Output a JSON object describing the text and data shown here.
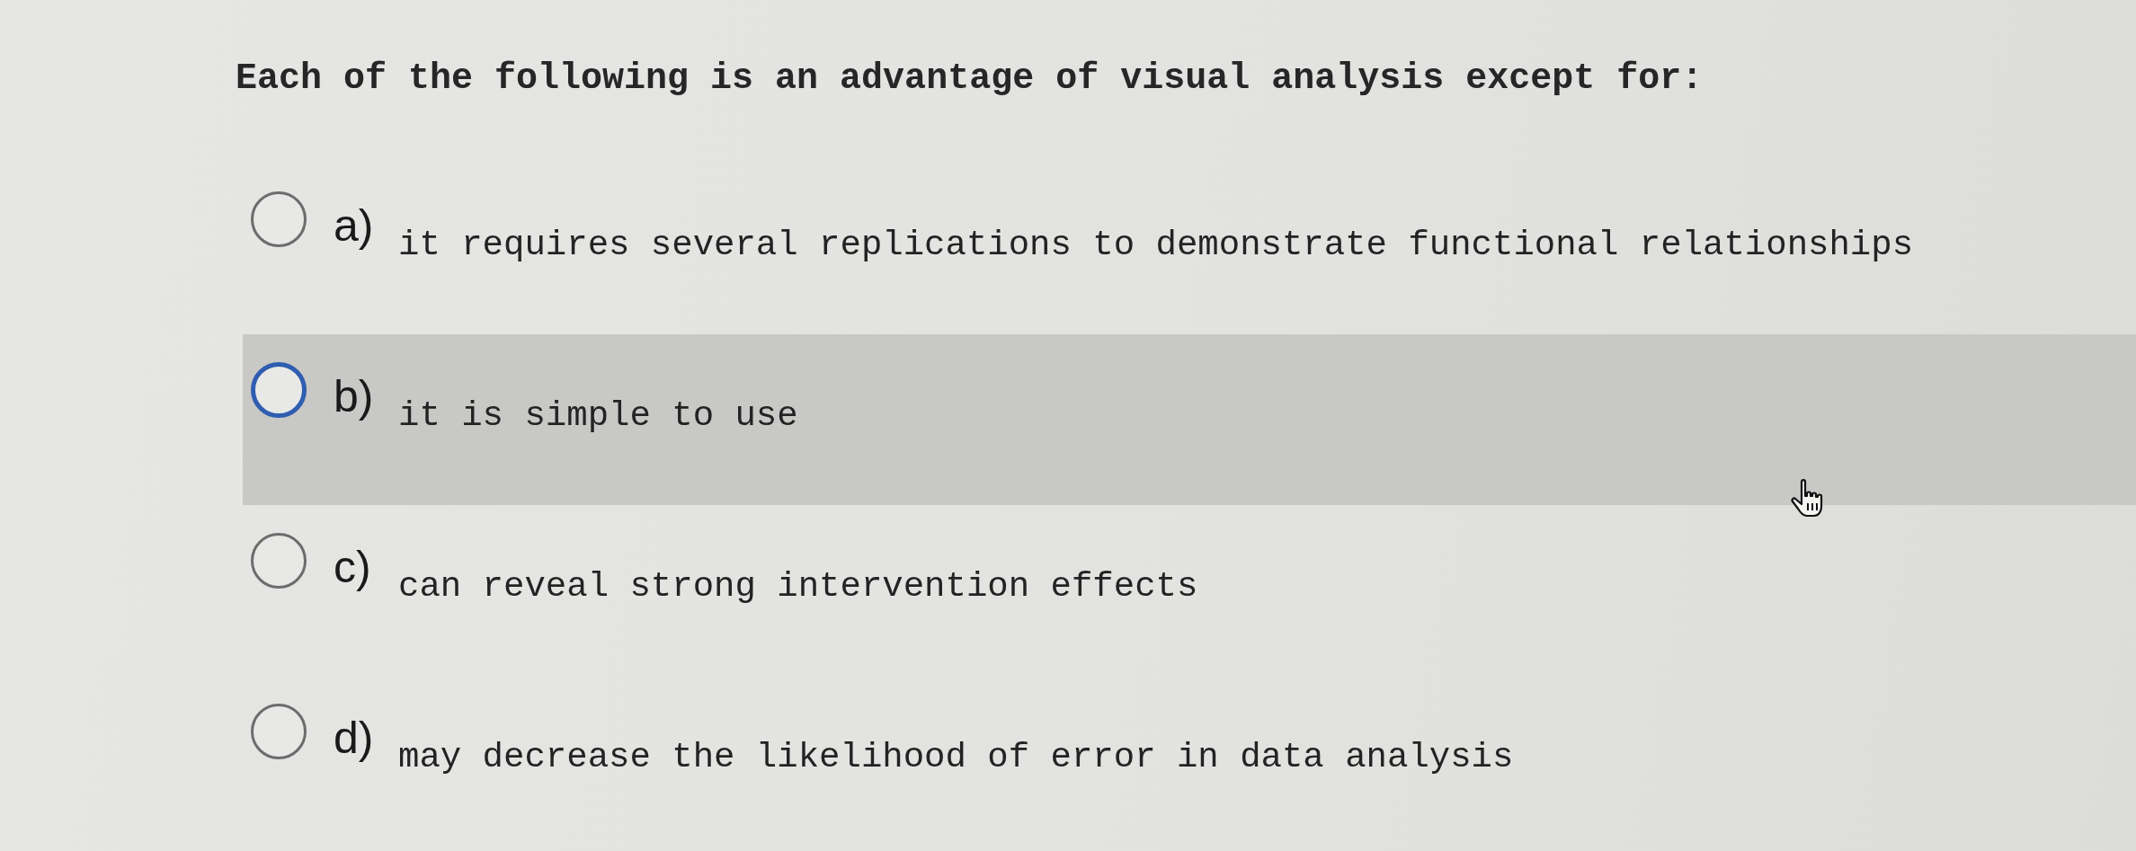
{
  "question": "Each of the following is an advantage of visual analysis except for:",
  "options": [
    {
      "letter": "a)",
      "text": "it requires several replications to demonstrate functional relationships",
      "selected": false,
      "hovered": false
    },
    {
      "letter": "b)",
      "text": "it is simple to use",
      "selected": false,
      "hovered": true
    },
    {
      "letter": "c)",
      "text": "can reveal strong intervention effects",
      "selected": false,
      "hovered": false
    },
    {
      "letter": "d)",
      "text": "may decrease the likelihood of error in data analysis",
      "selected": false,
      "hovered": false
    }
  ]
}
